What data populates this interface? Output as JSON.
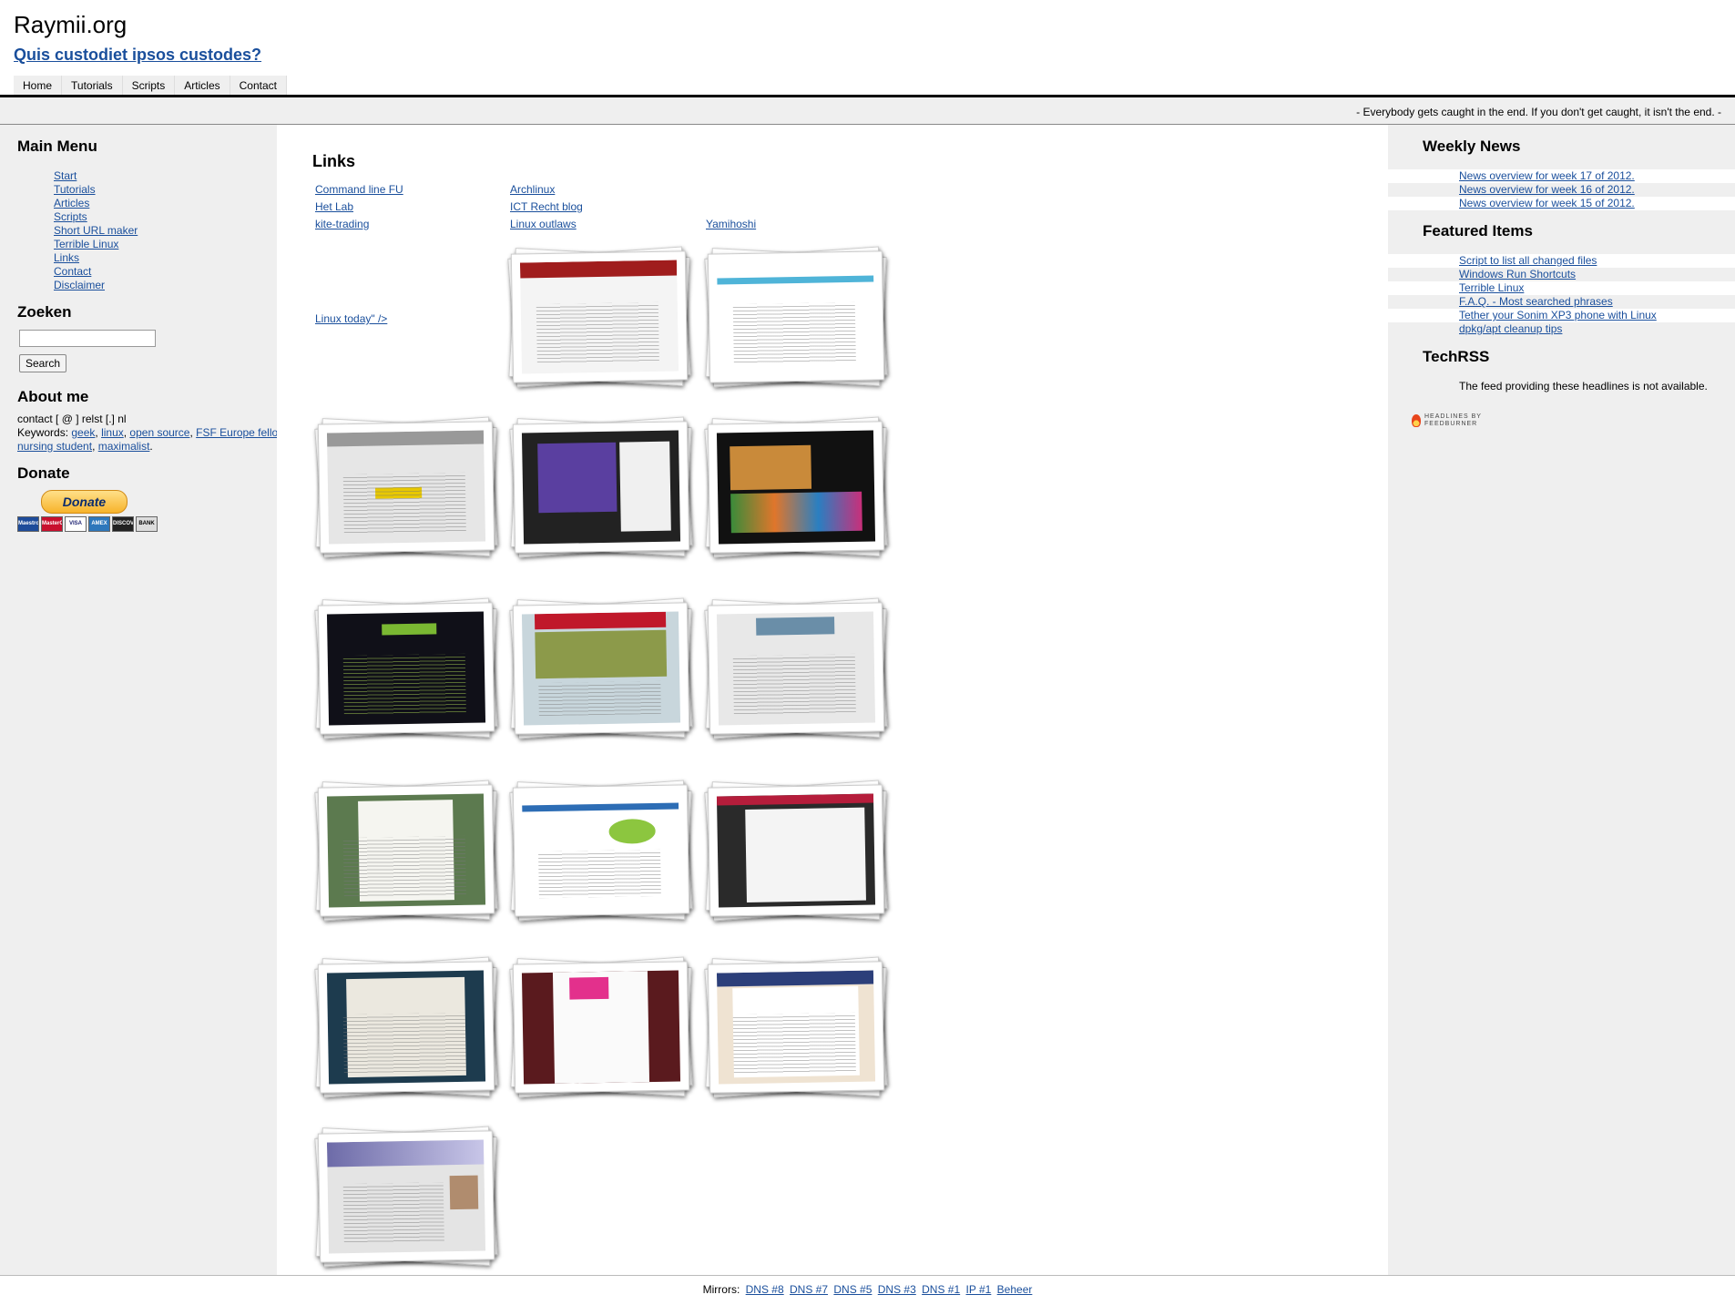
{
  "header": {
    "site_title": "Raymii.org",
    "tagline": "Quis custodiet ipsos custodes?",
    "nav": [
      "Home",
      "Tutorials",
      "Scripts",
      "Articles",
      "Contact"
    ],
    "quote": "- Everybody gets caught in the end. If you don't get caught, it isn't the end. -"
  },
  "left": {
    "main_menu_title": "Main Menu",
    "menu": [
      "Start",
      "Tutorials",
      "Articles",
      "Scripts",
      "Short URL maker",
      "Terrible Linux",
      "Links",
      "Contact",
      "Disclaimer"
    ],
    "search_title": "Zoeken",
    "search_value": "",
    "search_button": "Search",
    "about_title": "About me",
    "contact_line": "contact [ @ ] relst [.] nl",
    "keywords_label": "Keywords: ",
    "keywords": [
      "geek",
      "linux",
      "open source",
      "FSF Europe fellow",
      "nursing student",
      "maximalist"
    ],
    "donate_title": "Donate",
    "donate_button": "Donate",
    "cards": [
      "Maestro",
      "MasterCard",
      "VISA",
      "AMEX",
      "DISCOVER",
      "BANK"
    ]
  },
  "main": {
    "title": "Links",
    "links": {
      "command_line_fu": "Command line FU",
      "archlinux": "Archlinux",
      "het_lab": "Het Lab",
      "ict_recht_blog": "ICT Recht blog",
      "kite_trading": "kite-trading",
      "linux_outlaws": "Linux outlaws",
      "yamihoshi": "Yamihoshi",
      "linux_today": "Linux today\" />"
    }
  },
  "right": {
    "weekly_title": "Weekly News",
    "weekly": [
      "News overview for week 17 of 2012.",
      "News overview for week 16 of 2012.",
      "News overview for week 15 of 2012."
    ],
    "featured_title": "Featured Items",
    "featured": [
      "Script to list all changed files",
      "Windows Run Shortcuts",
      "Terrible Linux",
      "F.A.Q. - Most searched phrases",
      "Tether your Sonim XP3 phone with Linux",
      "dpkg/apt cleanup tips"
    ],
    "techrss_title": "TechRSS",
    "feed_message": "The feed providing these headlines is not available.",
    "feedburner_line1": "HEADLINES BY",
    "feedburner_line2": "FEEDBURNER"
  },
  "footer": {
    "label": "Mirrors:",
    "mirrors": [
      "DNS #8",
      "DNS #7",
      "DNS #5",
      "DNS #3",
      "DNS #1",
      "IP #1",
      "Beheer"
    ]
  }
}
